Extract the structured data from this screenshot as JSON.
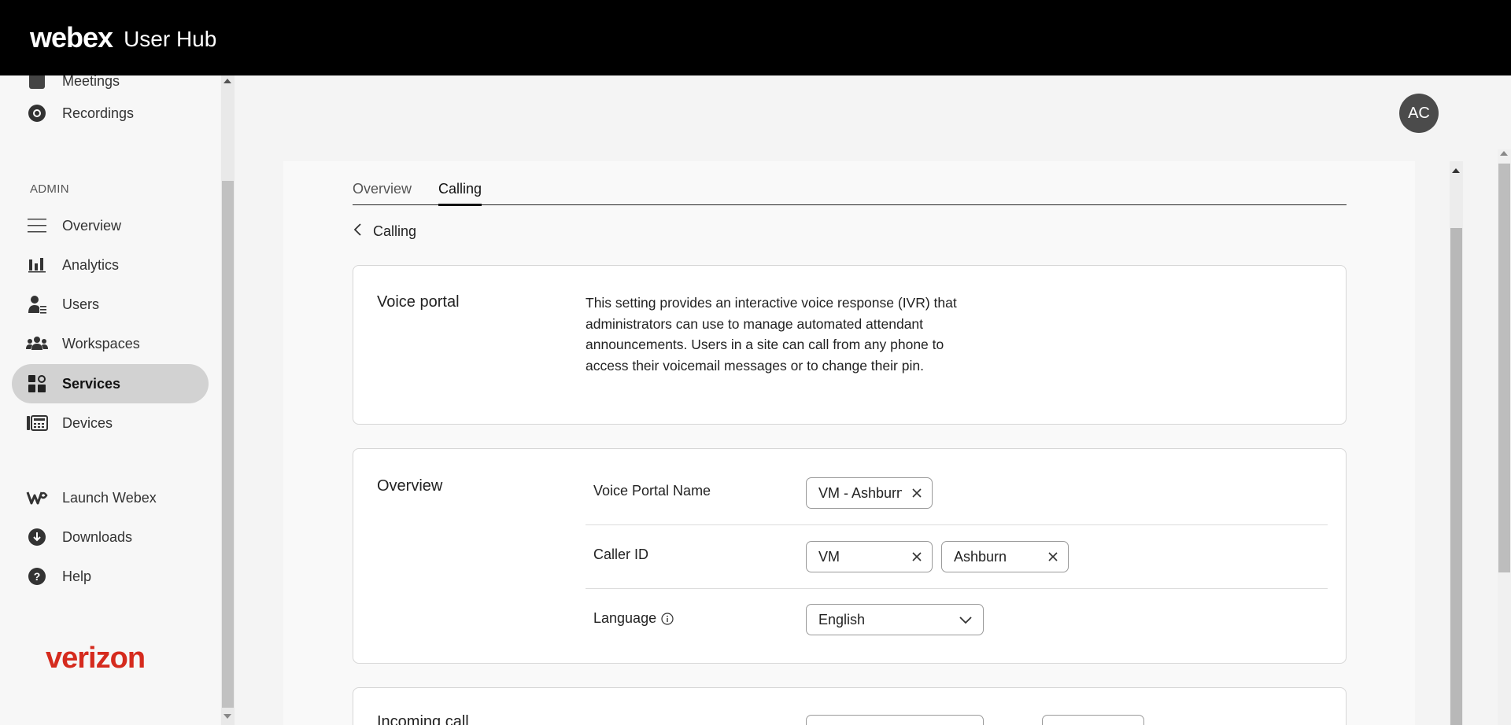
{
  "header": {
    "brand": "webex",
    "product": "User Hub"
  },
  "user": {
    "initials": "AC"
  },
  "sidebar": {
    "top_items": [
      {
        "label": "Meetings",
        "icon": "calendar-icon"
      },
      {
        "label": "Recordings",
        "icon": "recordings-icon"
      }
    ],
    "admin_section_label": "ADMIN",
    "admin_items": [
      {
        "label": "Overview",
        "icon": "menu-lines-icon"
      },
      {
        "label": "Analytics",
        "icon": "bar-chart-icon"
      },
      {
        "label": "Users",
        "icon": "users-icon"
      },
      {
        "label": "Workspaces",
        "icon": "workspaces-icon"
      },
      {
        "label": "Services",
        "icon": "services-icon",
        "active": true
      },
      {
        "label": "Devices",
        "icon": "devices-icon"
      }
    ],
    "bottom_items": [
      {
        "label": "Launch Webex",
        "icon": "webex-logo-icon"
      },
      {
        "label": "Downloads",
        "icon": "download-icon"
      },
      {
        "label": "Help",
        "icon": "help-icon"
      }
    ],
    "footer_logo": "verizon"
  },
  "tabs": [
    {
      "label": "Overview",
      "active": false
    },
    {
      "label": "Calling",
      "active": true
    }
  ],
  "breadcrumb": {
    "back_label": "Calling"
  },
  "voice_portal": {
    "title": "Voice portal",
    "description": "This setting provides an interactive voice response (IVR) that administrators can use to manage automated attendant announcements. Users in a site can call from any phone to access their voicemail messages or to change their pin."
  },
  "overview": {
    "title": "Overview",
    "voice_portal_name_label": "Voice Portal Name",
    "voice_portal_name_value": "VM - Ashburn",
    "caller_id_label": "Caller ID",
    "caller_id_first": "VM",
    "caller_id_last": "Ashburn",
    "language_label": "Language",
    "language_value": "English"
  },
  "incoming_call": {
    "title": "Incoming call"
  },
  "colors": {
    "active_nav_bg": "#d2d2d2",
    "topbar": "#000000",
    "verizon_red": "#d52b1e"
  }
}
